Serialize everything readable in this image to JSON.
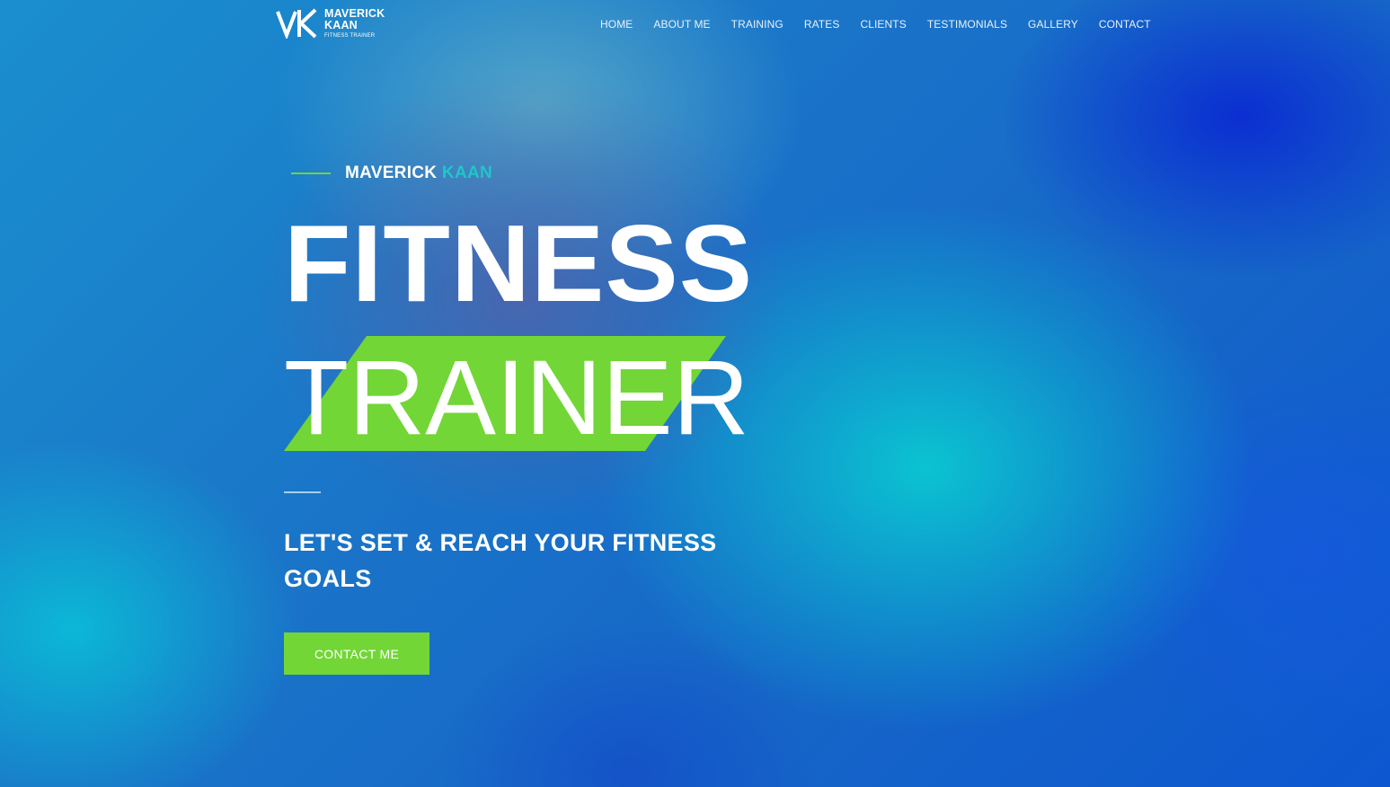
{
  "brand": {
    "name_line1": "MAVERICK",
    "name_line2": "KAAN",
    "subtitle": "FITNESS TRAINER"
  },
  "nav": {
    "items": [
      {
        "label": "HOME"
      },
      {
        "label": "ABOUT ME"
      },
      {
        "label": "TRAINING"
      },
      {
        "label": "RATES"
      },
      {
        "label": "CLIENTS"
      },
      {
        "label": "TESTIMONIALS"
      },
      {
        "label": "GALLERY"
      },
      {
        "label": "CONTACT"
      }
    ]
  },
  "hero": {
    "eyebrow_first": "MAVERICK",
    "eyebrow_accent": "KAAN",
    "heading_line1": "FITNESS",
    "heading_line2": "TRAINER",
    "tagline": "LET'S SET & REACH YOUR FITNESS GOALS",
    "cta_label": "CONTACT ME"
  },
  "colors": {
    "accent_green": "#72d636",
    "accent_teal": "#1fc6c9",
    "background_blue": "#1a74c8"
  }
}
